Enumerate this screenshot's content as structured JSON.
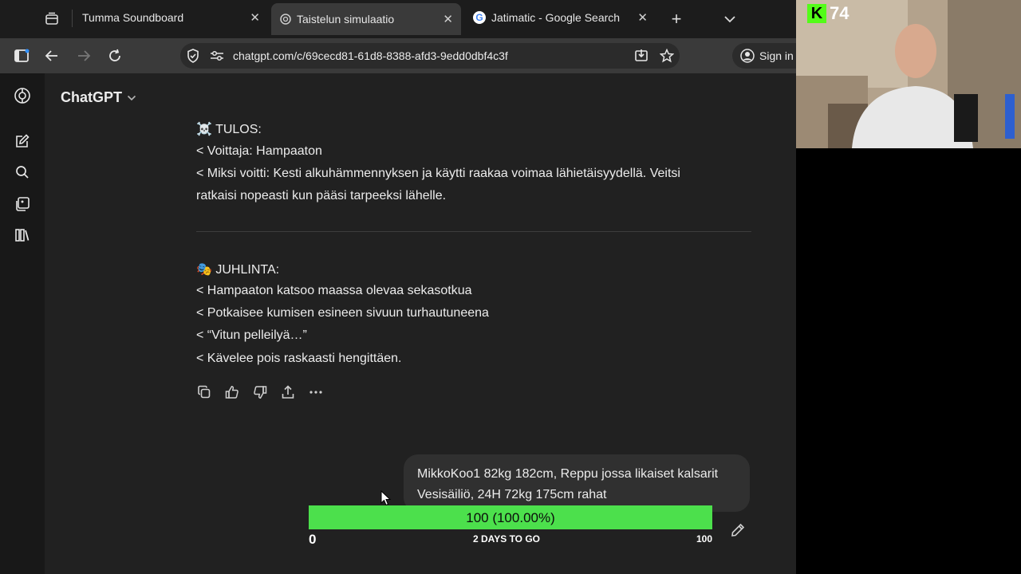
{
  "tabs": [
    {
      "label": "Tumma Soundboard"
    },
    {
      "label": "Taistelun simulaatio"
    },
    {
      "label": "Jatimatic - Google Search"
    }
  ],
  "tab_close": "✕",
  "tab_add": "+",
  "address": {
    "url": "chatgpt.com/c/69cecd81-61d8-8388-afd3-9edd0dbf4c3f",
    "signin_label": "Sign in"
  },
  "app": {
    "name": "ChatGPT"
  },
  "message": {
    "lines": [
      "☠️ TULOS:",
      "< Voittaja: Hampaaton",
      "< Miksi voitti: Kesti alkuhämmennyksen ja käytti raakaa voimaa lähietäisyydellä. Veitsi",
      "ratkaisi nopeasti kun pääsi tarpeeksi lähelle.",
      "🎭 JUHLINTA:",
      "< Hampaaton katsoo maassa olevaa sekasotkua",
      "< Potkaisee kumisen esineen sivuun turhautuneena",
      "< “Vitun pelleilyä…”",
      "< Kävelee pois raskaasti hengittäen."
    ]
  },
  "user_message": {
    "line1": "MikkoKoo1 82kg 182cm, Reppu jossa likaiset kalsarit",
    "line2": "Vesisäiliö, 24H 72kg 175cm rahat"
  },
  "overlay_progress": {
    "text": "100 (100.00%)",
    "min": "0",
    "max": "100",
    "label": "2 DAYS TO GO",
    "fill_fraction": 1.0,
    "color": "#4ce04c"
  },
  "kick": {
    "letter": "K",
    "viewers": "74",
    "color": "#53fc18"
  }
}
